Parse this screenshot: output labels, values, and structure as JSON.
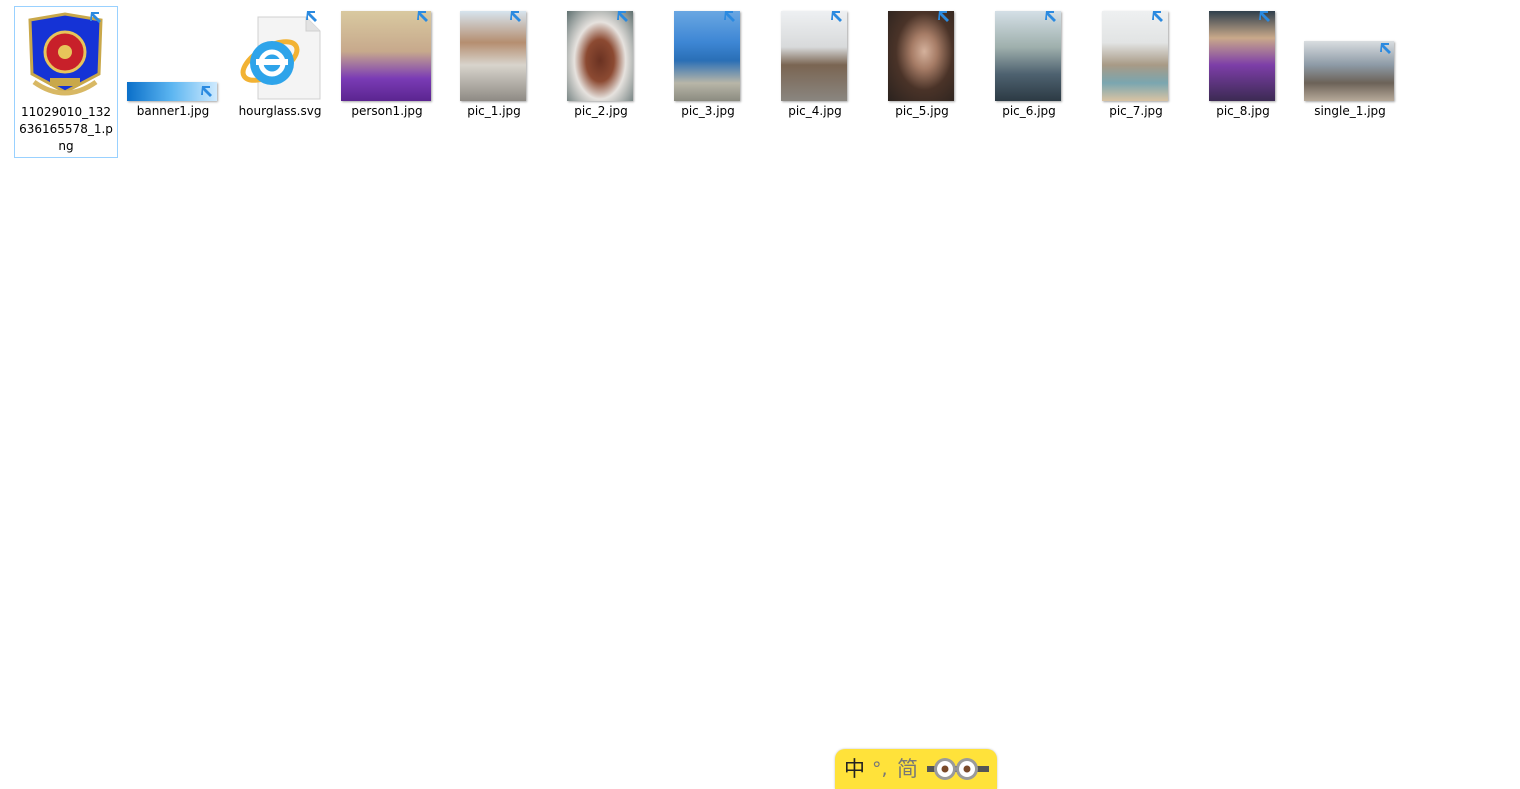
{
  "files": [
    {
      "name": "11029010_132636165578_1.png",
      "kind": "emblem",
      "selected": true
    },
    {
      "name": "banner1.jpg",
      "kind": "banner"
    },
    {
      "name": "hourglass.svg",
      "kind": "ie-document"
    },
    {
      "name": "person1.jpg",
      "kind": "photo-person-hat"
    },
    {
      "name": "pic_1.jpg",
      "kind": "photo-road"
    },
    {
      "name": "pic_2.jpg",
      "kind": "photo-steak"
    },
    {
      "name": "pic_3.jpg",
      "kind": "photo-fjord"
    },
    {
      "name": "pic_4.jpg",
      "kind": "photo-animal-rocks"
    },
    {
      "name": "pic_5.jpg",
      "kind": "photo-portrait"
    },
    {
      "name": "pic_6.jpg",
      "kind": "photo-city"
    },
    {
      "name": "pic_7.jpg",
      "kind": "photo-coast"
    },
    {
      "name": "pic_8.jpg",
      "kind": "photo-person-boat"
    },
    {
      "name": "single_1.jpg",
      "kind": "photo-street"
    }
  ],
  "ime_toolbar": {
    "mode": "中",
    "punctuation": "°,",
    "script": "简"
  },
  "colors": {
    "selection_border": "#99d1ff",
    "shortcut_arrow": "#2b8ae0",
    "ime_background": "#ffe23a"
  }
}
